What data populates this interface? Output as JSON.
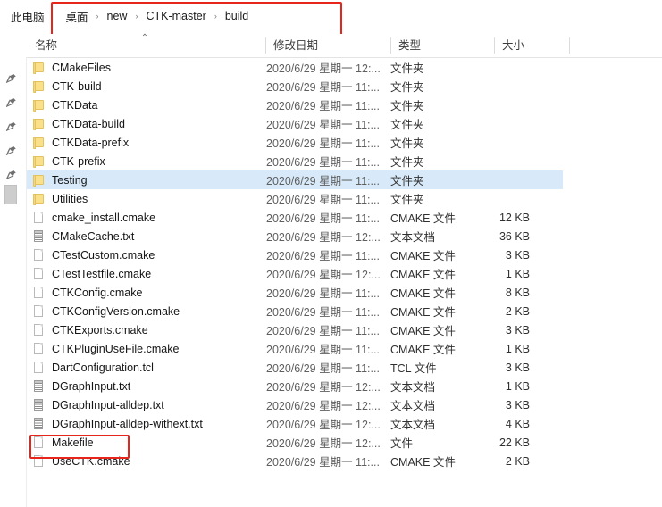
{
  "window": {
    "this_pc_label": "此电脑"
  },
  "breadcrumb": {
    "separator": "›",
    "items": [
      {
        "label": "桌面"
      },
      {
        "label": "new"
      },
      {
        "label": "CTK-master"
      },
      {
        "label": "build"
      }
    ],
    "expand_chevron": "⌃"
  },
  "columns": [
    {
      "key": "name",
      "label": "名称"
    },
    {
      "key": "date",
      "label": "修改日期"
    },
    {
      "key": "type",
      "label": "类型"
    },
    {
      "key": "size",
      "label": "大小"
    }
  ],
  "nav_pane": {
    "pin_icon": "📌",
    "pin_count": 5,
    "scrollbar_thumb": "nav-scroll-thumb"
  },
  "files": [
    {
      "name": "CMakeFiles",
      "icon": "folder",
      "date": "2020/6/29 星期一 12:...",
      "type": "文件夹",
      "size": "",
      "selected": false
    },
    {
      "name": "CTK-build",
      "icon": "folder",
      "date": "2020/6/29 星期一 11:...",
      "type": "文件夹",
      "size": "",
      "selected": false
    },
    {
      "name": "CTKData",
      "icon": "folder",
      "date": "2020/6/29 星期一 11:...",
      "type": "文件夹",
      "size": "",
      "selected": false
    },
    {
      "name": "CTKData-build",
      "icon": "folder",
      "date": "2020/6/29 星期一 11:...",
      "type": "文件夹",
      "size": "",
      "selected": false
    },
    {
      "name": "CTKData-prefix",
      "icon": "folder",
      "date": "2020/6/29 星期一 11:...",
      "type": "文件夹",
      "size": "",
      "selected": false
    },
    {
      "name": "CTK-prefix",
      "icon": "folder",
      "date": "2020/6/29 星期一 11:...",
      "type": "文件夹",
      "size": "",
      "selected": false
    },
    {
      "name": "Testing",
      "icon": "folder",
      "date": "2020/6/29 星期一 11:...",
      "type": "文件夹",
      "size": "",
      "selected": true
    },
    {
      "name": "Utilities",
      "icon": "folder",
      "date": "2020/6/29 星期一 11:...",
      "type": "文件夹",
      "size": "",
      "selected": false
    },
    {
      "name": "cmake_install.cmake",
      "icon": "file",
      "date": "2020/6/29 星期一 11:...",
      "type": "CMAKE 文件",
      "size": "12 KB",
      "selected": false
    },
    {
      "name": "CMakeCache.txt",
      "icon": "txt",
      "date": "2020/6/29 星期一 12:...",
      "type": "文本文档",
      "size": "36 KB",
      "selected": false
    },
    {
      "name": "CTestCustom.cmake",
      "icon": "file",
      "date": "2020/6/29 星期一 11:...",
      "type": "CMAKE 文件",
      "size": "3 KB",
      "selected": false
    },
    {
      "name": "CTestTestfile.cmake",
      "icon": "file",
      "date": "2020/6/29 星期一 12:...",
      "type": "CMAKE 文件",
      "size": "1 KB",
      "selected": false
    },
    {
      "name": "CTKConfig.cmake",
      "icon": "file",
      "date": "2020/6/29 星期一 11:...",
      "type": "CMAKE 文件",
      "size": "8 KB",
      "selected": false
    },
    {
      "name": "CTKConfigVersion.cmake",
      "icon": "file",
      "date": "2020/6/29 星期一 11:...",
      "type": "CMAKE 文件",
      "size": "2 KB",
      "selected": false
    },
    {
      "name": "CTKExports.cmake",
      "icon": "file",
      "date": "2020/6/29 星期一 11:...",
      "type": "CMAKE 文件",
      "size": "3 KB",
      "selected": false
    },
    {
      "name": "CTKPluginUseFile.cmake",
      "icon": "file",
      "date": "2020/6/29 星期一 11:...",
      "type": "CMAKE 文件",
      "size": "1 KB",
      "selected": false
    },
    {
      "name": "DartConfiguration.tcl",
      "icon": "file",
      "date": "2020/6/29 星期一 11:...",
      "type": "TCL 文件",
      "size": "3 KB",
      "selected": false
    },
    {
      "name": "DGraphInput.txt",
      "icon": "txt",
      "date": "2020/6/29 星期一 12:...",
      "type": "文本文档",
      "size": "1 KB",
      "selected": false
    },
    {
      "name": "DGraphInput-alldep.txt",
      "icon": "txt",
      "date": "2020/6/29 星期一 12:...",
      "type": "文本文档",
      "size": "3 KB",
      "selected": false
    },
    {
      "name": "DGraphInput-alldep-withext.txt",
      "icon": "txt",
      "date": "2020/6/29 星期一 12:...",
      "type": "文本文档",
      "size": "4 KB",
      "selected": false
    },
    {
      "name": "Makefile",
      "icon": "file",
      "date": "2020/6/29 星期一 12:...",
      "type": "文件",
      "size": "22 KB",
      "selected": false
    },
    {
      "name": "UseCTK.cmake",
      "icon": "file",
      "date": "2020/6/29 星期一 11:...",
      "type": "CMAKE 文件",
      "size": "2 KB",
      "selected": false
    }
  ],
  "annotations": {
    "color": "#e8251b",
    "boxes": [
      {
        "name": "breadcrumb-highlight",
        "target": "breadcrumb"
      },
      {
        "name": "makefile-highlight",
        "target": "Makefile"
      }
    ]
  }
}
